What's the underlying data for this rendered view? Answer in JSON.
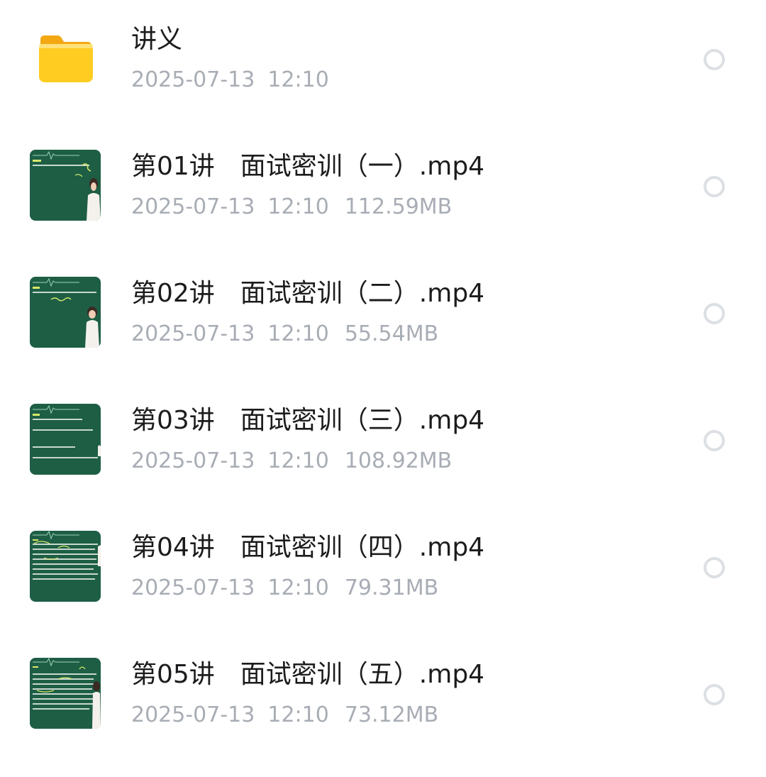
{
  "files": [
    {
      "type": "folder",
      "icon": "folder-icon",
      "name": "讲义",
      "date": "2025-07-13",
      "time": "12:10",
      "size": ""
    },
    {
      "type": "video",
      "icon": "video-thumbnail",
      "name": "第01讲　面试密训（一）.mp4",
      "date": "2025-07-13",
      "time": "12:10",
      "size": "112.59MB"
    },
    {
      "type": "video",
      "icon": "video-thumbnail",
      "name": "第02讲　面试密训（二）.mp4",
      "date": "2025-07-13",
      "time": "12:10",
      "size": "55.54MB"
    },
    {
      "type": "video",
      "icon": "video-thumbnail",
      "name": "第03讲　面试密训（三）.mp4",
      "date": "2025-07-13",
      "time": "12:10",
      "size": "108.92MB"
    },
    {
      "type": "video",
      "icon": "video-thumbnail",
      "name": "第04讲　面试密训（四）.mp4",
      "date": "2025-07-13",
      "time": "12:10",
      "size": "79.31MB"
    },
    {
      "type": "video",
      "icon": "video-thumbnail",
      "name": "第05讲　面试密训（五）.mp4",
      "date": "2025-07-13",
      "time": "12:10",
      "size": "73.12MB"
    }
  ],
  "colors": {
    "folder": "#ffc61a",
    "thumbnail_bg": "#1d5e45",
    "title_text": "#1c1c1e",
    "meta_text": "#a8adb5",
    "radio_border": "#dcdfe3"
  }
}
